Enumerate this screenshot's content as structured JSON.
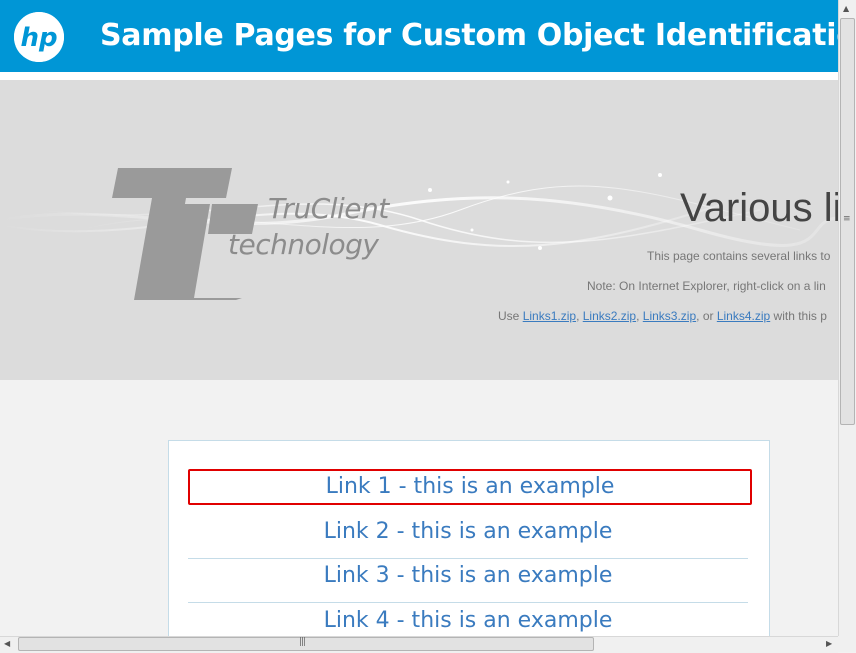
{
  "header": {
    "title": "Sample Pages for Custom Object Identification",
    "logo_icon": "hp-logo-icon",
    "brand_color": "#0096d6"
  },
  "banner": {
    "brand_line1": "TruClient",
    "brand_line2": "technology",
    "heading": "Various li",
    "line1": "This page contains several links to",
    "line2": "Note: On Internet Explorer, right-click on a lin",
    "line3": {
      "prefix": "Use ",
      "link1": "Links1.zip",
      "sep1": ", ",
      "link2": "Links2.zip",
      "sep2": ", ",
      "link3": "Links3.zip",
      "sep3": ", or ",
      "link4": "Links4.zip",
      "suffix": " with this p"
    }
  },
  "links": [
    {
      "label": "Link 1 - this is an example",
      "selected": true
    },
    {
      "label": "Link 2 - this is an example",
      "selected": false
    },
    {
      "label": "Link 3 - this is an example",
      "selected": false
    },
    {
      "label": "Link 4 - this is an example",
      "selected": false
    }
  ],
  "colors": {
    "link": "#3a7bbf",
    "selection": "#e00000"
  }
}
